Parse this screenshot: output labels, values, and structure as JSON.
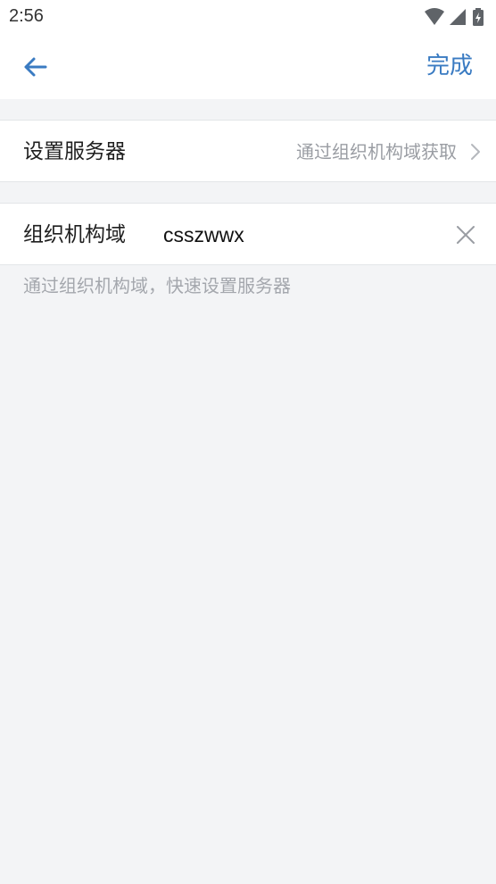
{
  "status_bar": {
    "time": "2:56",
    "icons": [
      "wifi-icon",
      "cellular-signal-icon",
      "battery-charging-icon"
    ]
  },
  "toolbar": {
    "back_icon": "arrow-left-icon",
    "done_label": "完成"
  },
  "server_row": {
    "label": "设置服务器",
    "value": "通过组织机构域获取",
    "icon": "chevron-right-icon"
  },
  "domain_row": {
    "label": "组织机构域",
    "input_value": "csszwwx",
    "clear_icon": "close-icon"
  },
  "hint": "通过组织机构域，快速设置服务器",
  "colors": {
    "accent": "#3a7bc2",
    "background": "#f3f4f6",
    "secondary_text": "#9a9da3"
  }
}
